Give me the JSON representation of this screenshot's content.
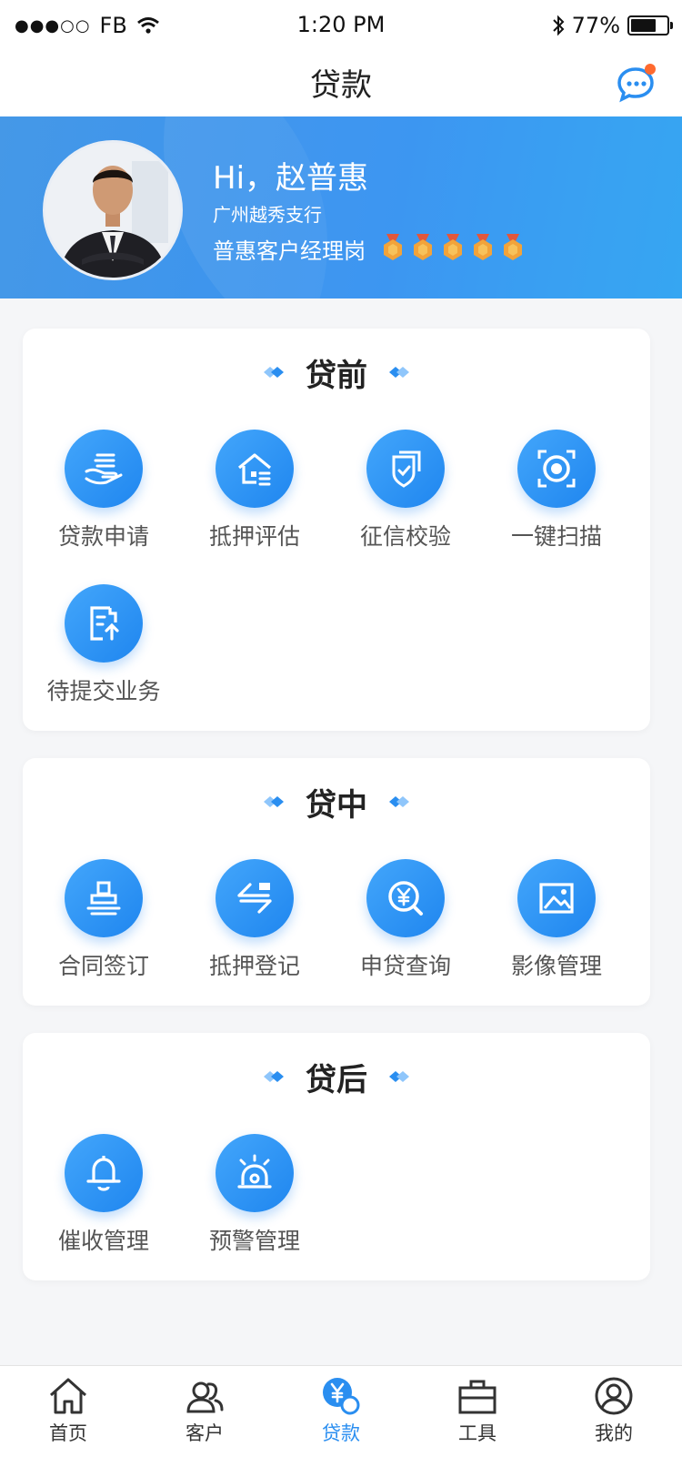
{
  "status_bar": {
    "carrier": "FB",
    "time": "1:20 PM",
    "battery": "77%",
    "battery_level": 0.77
  },
  "nav": {
    "title": "贷款",
    "message_icon": "chat-bubble-icon",
    "has_notification": true
  },
  "profile": {
    "greeting": "Hi，赵普惠",
    "branch": "广州越秀支行",
    "role": "普惠客户经理岗",
    "medal_count": 5
  },
  "sections": [
    {
      "title": "贷前",
      "items": [
        {
          "label": "贷款申请",
          "icon": "loan-apply-icon"
        },
        {
          "label": "抵押评估",
          "icon": "house-evaluate-icon"
        },
        {
          "label": "征信校验",
          "icon": "shield-check-icon"
        },
        {
          "label": "一键扫描",
          "icon": "scan-icon"
        },
        {
          "label": "待提交业务",
          "icon": "document-upload-icon"
        }
      ]
    },
    {
      "title": "贷中",
      "items": [
        {
          "label": "合同签订",
          "icon": "stamp-icon"
        },
        {
          "label": "抵押登记",
          "icon": "transfer-icon"
        },
        {
          "label": "申贷查询",
          "icon": "yuan-search-icon"
        },
        {
          "label": "影像管理",
          "icon": "image-icon"
        }
      ]
    },
    {
      "title": "贷后",
      "items": [
        {
          "label": "催收管理",
          "icon": "bell-icon"
        },
        {
          "label": "预警管理",
          "icon": "alarm-icon"
        }
      ]
    }
  ],
  "tabs": [
    {
      "label": "首页",
      "icon": "home-icon",
      "active": false
    },
    {
      "label": "客户",
      "icon": "customers-icon",
      "active": false
    },
    {
      "label": "贷款",
      "icon": "loan-yuan-icon",
      "active": true
    },
    {
      "label": "工具",
      "icon": "toolbox-icon",
      "active": false
    },
    {
      "label": "我的",
      "icon": "profile-icon",
      "active": false
    }
  ],
  "colors": {
    "accent": "#2a8ef0",
    "banner_start": "#3b93e6",
    "banner_end": "#27a0f2",
    "medal": "#f2a33a",
    "notification_dot": "#ff6a2f"
  }
}
